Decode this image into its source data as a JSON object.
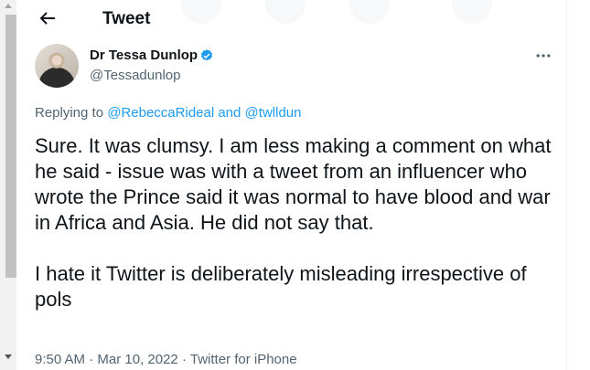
{
  "header": {
    "title": "Tweet",
    "back_icon": "arrow-left-icon"
  },
  "author": {
    "display_name": "Dr Tessa Dunlop",
    "handle": "@Tessadunlop",
    "verified": true,
    "verified_color": "#1d9bf0"
  },
  "reply": {
    "prefix": "Replying to",
    "user1": "@RebeccaRideal",
    "connector": "and",
    "user2": "@twlldun"
  },
  "tweet": {
    "paragraph1": "Sure. It was clumsy. I am less making a comment on what he said - issue was with a tweet from an influencer who wrote the Prince said it was normal to have blood and war in Africa and Asia. He did not say that.",
    "paragraph2": "I hate it Twitter is deliberately misleading irrespective of pols"
  },
  "meta": {
    "time": "9:50 AM",
    "separator": "·",
    "date": "Mar 10, 2022",
    "source": "Twitter for iPhone"
  },
  "colors": {
    "accent": "#1d9bf0",
    "text": "#0f1419",
    "secondary": "#536471"
  }
}
